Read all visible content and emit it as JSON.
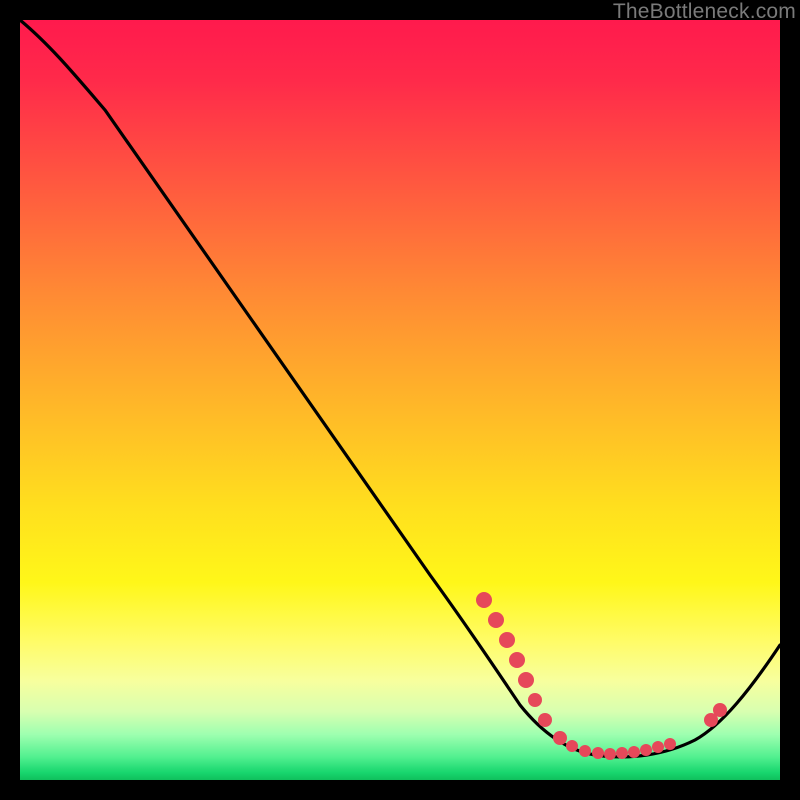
{
  "watermark": "TheBottleneck.com",
  "chart_data": {
    "type": "line",
    "title": "",
    "xlabel": "",
    "ylabel": "",
    "xlim": [
      0,
      100
    ],
    "ylim": [
      0,
      100
    ],
    "series": [
      {
        "name": "curve",
        "x": [
          0,
          6,
          12,
          20,
          28,
          36,
          44,
          52,
          60,
          65,
          68,
          72,
          76,
          80,
          84,
          88,
          91,
          95,
          100
        ],
        "y": [
          100,
          96,
          91,
          82,
          71,
          60,
          49,
          38,
          27,
          18,
          12,
          7,
          4,
          3,
          3,
          4,
          6,
          10,
          17
        ]
      }
    ],
    "markers": {
      "description": "red dots along curve near minimum",
      "x": [
        61,
        63,
        65,
        67,
        70,
        72,
        74,
        76,
        78,
        80,
        82,
        84,
        86,
        91,
        93
      ],
      "y": [
        24,
        20,
        17,
        14,
        9,
        7,
        5,
        4,
        3.5,
        3,
        3,
        3.2,
        3.6,
        6,
        8
      ]
    },
    "gradient_stops": [
      {
        "pos": 0.0,
        "color": "#ff1a4d"
      },
      {
        "pos": 0.5,
        "color": "#ffdf1e"
      },
      {
        "pos": 0.85,
        "color": "#fffc6a"
      },
      {
        "pos": 1.0,
        "color": "#0fbf5c"
      }
    ]
  }
}
